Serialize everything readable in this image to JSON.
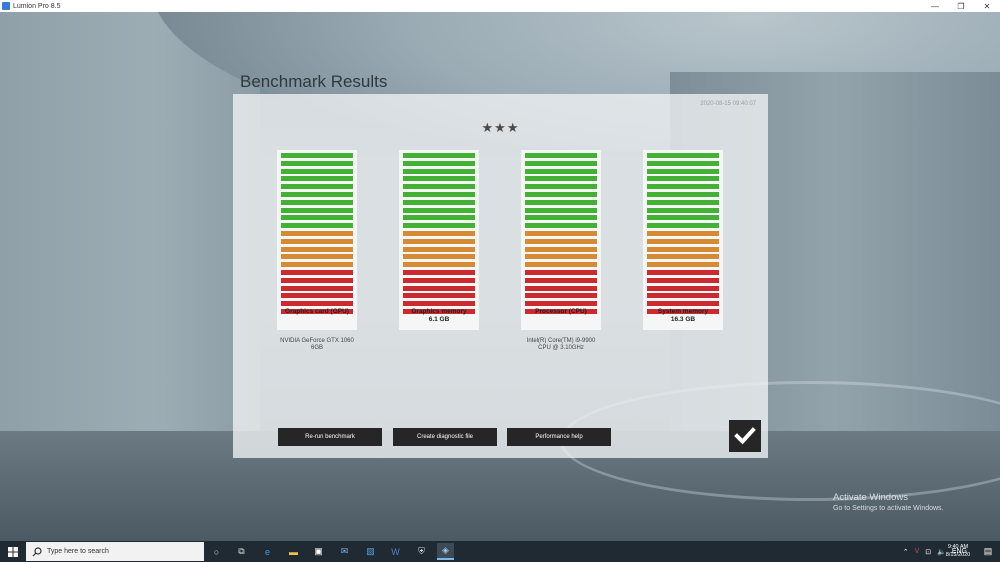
{
  "window": {
    "title": "Lumion Pro 8.5",
    "controls": [
      "—",
      "❐",
      "✕"
    ]
  },
  "page": {
    "heading": "Benchmark Results",
    "timestamp": "2020-08-15 09:40:07",
    "rating_stars": "★★★"
  },
  "meters": [
    {
      "label": "Graphics card (GPU)",
      "sublabel": "",
      "info_line1": "NVIDIA GeForce GTX 1060",
      "info_line2": "6GB"
    },
    {
      "label": "Graphics memory",
      "sublabel": "6.1 GB",
      "info_line1": "",
      "info_line2": ""
    },
    {
      "label": "Processor (CPU)",
      "sublabel": "",
      "info_line1": "Intel(R) Core(TM) i9-9900",
      "info_line2": "CPU @ 3.10GHz"
    },
    {
      "label": "System memory",
      "sublabel": "16.3 GB",
      "info_line1": "",
      "info_line2": ""
    }
  ],
  "meter_segments": {
    "green": 10,
    "orange": 5,
    "red": 6
  },
  "colors": {
    "green": "#43b133",
    "orange": "#d68a34",
    "red": "#cc2a2e"
  },
  "buttons": {
    "rerun": "Re-run benchmark",
    "diagnostic": "Create diagnostic file",
    "help": "Performance help",
    "ok": "✔"
  },
  "activation": {
    "title": "Activate Windows",
    "subtitle": "Go to Settings to activate Windows."
  },
  "taskbar": {
    "search_placeholder": "Type here to search",
    "language": "ENG",
    "time": "9:40 AM",
    "date": "8/15/2020"
  }
}
